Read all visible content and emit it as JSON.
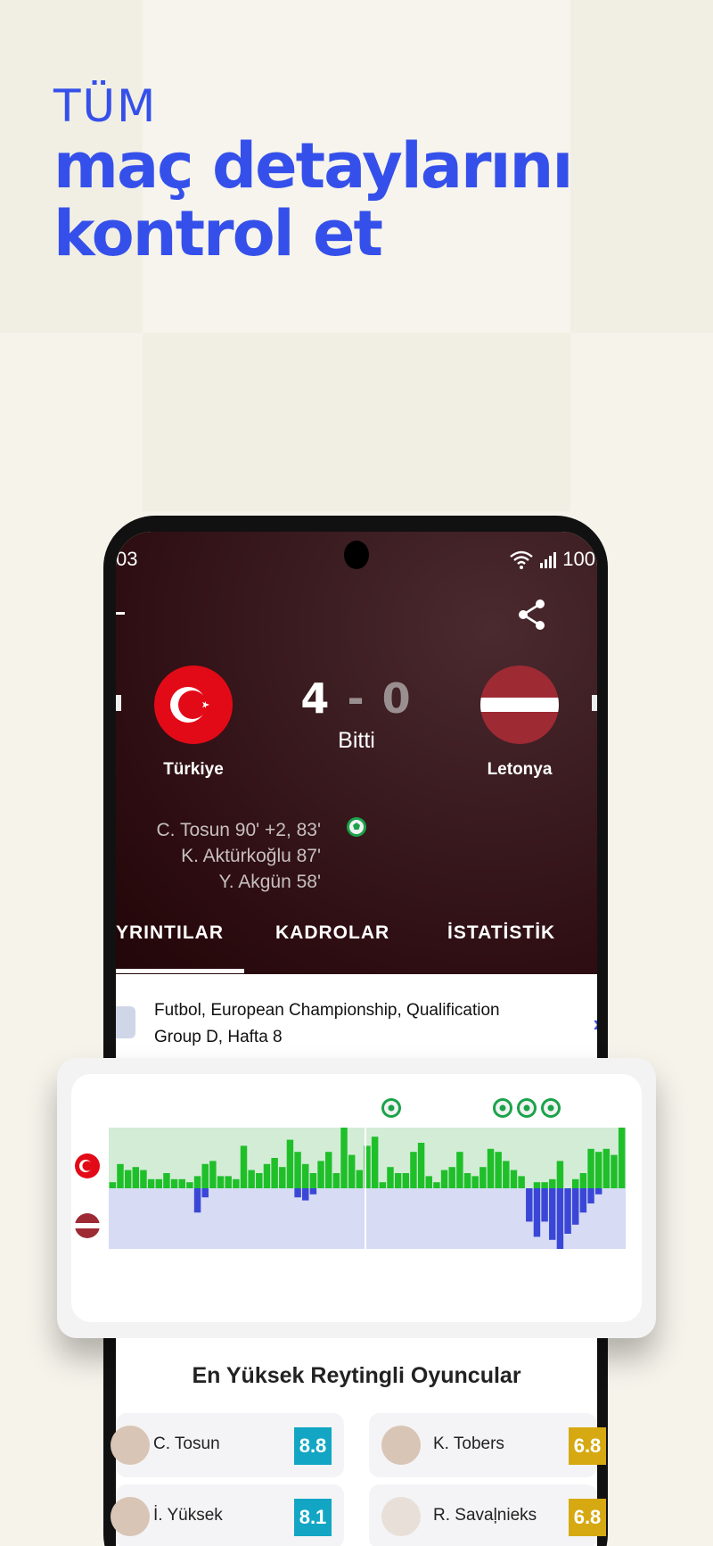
{
  "promo": {
    "line1": "TÜM",
    "line2": "maç detaylarını",
    "line3": "kontrol et"
  },
  "colors": {
    "accent": "#3550ea",
    "team1_bar": "#1fbf2a",
    "team2_bar": "#3a47d6",
    "rating_blue": "#12a6c4",
    "rating_gold": "#d6a912"
  },
  "status_bar": {
    "time": "03",
    "battery": "100",
    "icons": [
      "wifi-icon",
      "signal-icon"
    ]
  },
  "match": {
    "home": {
      "name": "Türkiye",
      "flag": "turkey-flag-icon"
    },
    "away": {
      "name": "Letonya",
      "flag": "latvia-flag-icon"
    },
    "home_score": "4",
    "separator": "-",
    "away_score": "0",
    "status": "Bitti",
    "scorers": [
      "C. Tosun 90' +2, 83'",
      "K. Aktürkoğlu 87'",
      "Y. Akgün 58'"
    ]
  },
  "tabs": [
    "YRINTILAR",
    "KADROLAR",
    "İSTATİSTİK"
  ],
  "competition": {
    "line1": "Futbol, European Championship, Qualification",
    "line2": "Group D, Hafta 8"
  },
  "chart_data": {
    "type": "bar",
    "series": [
      {
        "name": "Türkiye",
        "values": [
          2,
          8,
          6,
          7,
          6,
          3,
          3,
          5,
          3,
          3,
          2,
          4,
          8,
          9,
          4,
          4,
          3,
          14,
          6,
          5,
          8,
          10,
          7,
          16,
          12,
          8,
          5,
          9,
          12,
          5,
          20,
          11,
          6,
          14,
          17,
          2,
          7,
          5,
          5,
          12,
          15,
          4,
          2,
          6,
          7,
          12,
          5,
          4,
          7,
          13,
          12,
          9,
          6,
          4,
          0,
          2,
          2,
          3,
          9,
          0,
          3,
          5,
          13,
          12,
          13,
          11,
          20
        ]
      },
      {
        "name": "Letonya",
        "values": [
          0,
          0,
          0,
          0,
          0,
          0,
          0,
          0,
          0,
          0,
          0,
          8,
          3,
          0,
          0,
          0,
          0,
          0,
          0,
          0,
          0,
          0,
          0,
          0,
          3,
          4,
          2,
          0,
          0,
          0,
          0,
          0,
          0,
          0,
          0,
          0,
          0,
          0,
          0,
          0,
          0,
          0,
          0,
          0,
          0,
          0,
          0,
          0,
          0,
          0,
          0,
          0,
          0,
          0,
          11,
          16,
          11,
          17,
          20,
          15,
          12,
          8,
          5,
          2,
          0,
          0,
          0
        ]
      }
    ],
    "goal_markers": 4
  },
  "top_rated": {
    "title": "En Yüksek Reytingli Oyuncular",
    "players": [
      {
        "name": "C. Tosun",
        "rating": "8.8",
        "color": "#12a6c4"
      },
      {
        "name": "K. Tobers",
        "rating": "6.8",
        "color": "#d6a912"
      },
      {
        "name": "İ. Yüksek",
        "rating": "8.1",
        "color": "#12a6c4"
      },
      {
        "name": "R. Savaļnieks",
        "rating": "6.8",
        "color": "#d6a912"
      }
    ]
  }
}
